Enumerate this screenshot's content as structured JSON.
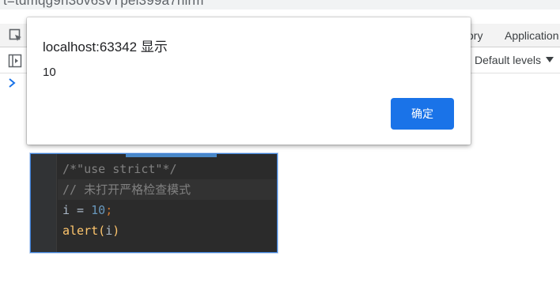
{
  "browser": {
    "url_fragment": "t=tdmqg9h3ov6svTpel399a7hlrm"
  },
  "devtools": {
    "tabs": [
      "ory",
      "Application"
    ],
    "levels_label": "Default levels"
  },
  "alert": {
    "title": "localhost:63342 显示",
    "message": "10",
    "ok_label": "确定",
    "ok_color": "#1a73e8"
  },
  "code_editor": {
    "line1": {
      "comment": "/*\"use strict\"*/"
    },
    "line2": {
      "comment": "// 未打开严格检查模式"
    },
    "line3": {
      "var": "i",
      "op": " = ",
      "num": "10",
      "punc": ";"
    },
    "line4": {
      "fn": "alert",
      "open": "(",
      "arg": "i",
      "close": ")"
    }
  }
}
